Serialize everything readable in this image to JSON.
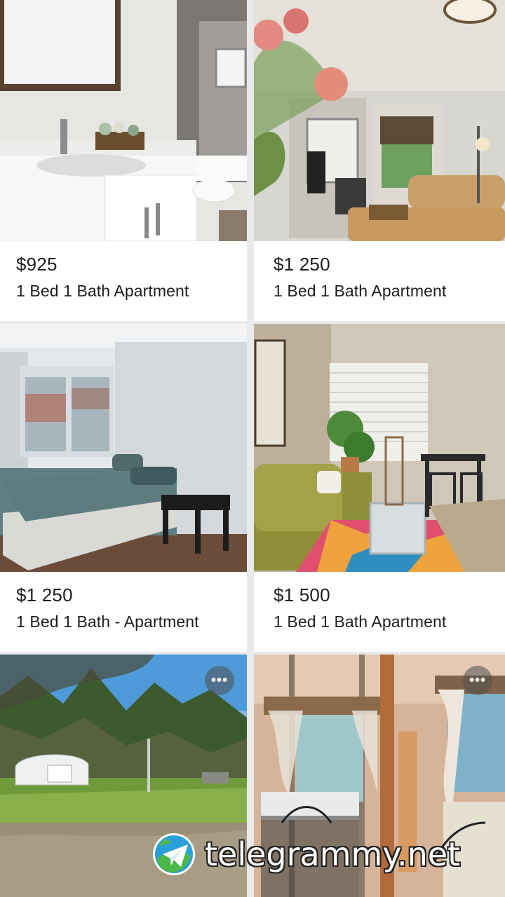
{
  "listings": [
    {
      "price": "$925",
      "title": "1 Bed 1 Bath Apartment",
      "photo_subject": "bathroom"
    },
    {
      "price": "$1 250",
      "title": "1 Bed 1 Bath Apartment",
      "photo_subject": "living-room"
    },
    {
      "price": "$1 250",
      "title": "1 Bed 1 Bath - Apartment",
      "photo_subject": "bedroom"
    },
    {
      "price": "$1 500",
      "title": "1 Bed 1 Bath Apartment",
      "photo_subject": "sunny-living-room"
    },
    {
      "price": "",
      "title": "",
      "photo_subject": "yard-with-garage",
      "more_icon": "more-horizontal-icon"
    },
    {
      "price": "",
      "title": "",
      "photo_subject": "bedroom-with-curtains",
      "more_icon": "more-horizontal-icon"
    }
  ],
  "more_button_label": "•••",
  "watermark": {
    "text": "telegrammy.net",
    "logo_icon": "paper-plane-globe-icon"
  },
  "colors": {
    "background": "#ffffff",
    "divider": "#e9eaec",
    "text": "#1c1e21"
  }
}
